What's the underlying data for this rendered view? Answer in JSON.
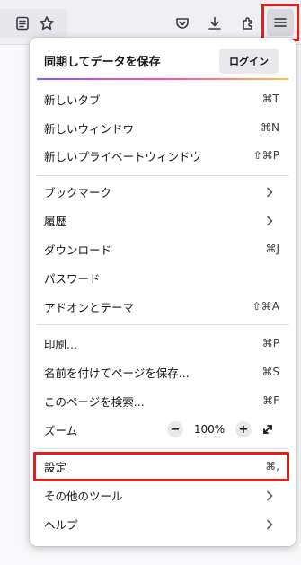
{
  "toolbar": {
    "icons": [
      "reader-view-icon",
      "bookmark-star-icon",
      "pocket-icon",
      "download-icon",
      "extensions-icon",
      "hamburger-menu-icon"
    ]
  },
  "menu": {
    "sync_label": "同期してデータを保存",
    "login_label": "ログイン",
    "items": {
      "new_tab": {
        "label": "新しいタブ",
        "shortcut": "⌘T"
      },
      "new_window": {
        "label": "新しいウィンドウ",
        "shortcut": "⌘N"
      },
      "new_private_window": {
        "label": "新しいプライベートウィンドウ",
        "shortcut": "⇧⌘P"
      },
      "bookmarks": {
        "label": "ブックマーク"
      },
      "history": {
        "label": "履歴"
      },
      "downloads": {
        "label": "ダウンロード",
        "shortcut": "⌘J"
      },
      "passwords": {
        "label": "パスワード"
      },
      "addons": {
        "label": "アドオンとテーマ",
        "shortcut": "⇧⌘A"
      },
      "print": {
        "label": "印刷...",
        "shortcut": "⌘P"
      },
      "save_page": {
        "label": "名前を付けてページを保存...",
        "shortcut": "⌘S"
      },
      "find": {
        "label": "このページを検索...",
        "shortcut": "⌘F"
      },
      "settings": {
        "label": "設定",
        "shortcut": "⌘,"
      },
      "more_tools": {
        "label": "その他のツール"
      },
      "help": {
        "label": "ヘルプ"
      }
    },
    "zoom": {
      "label": "ズーム",
      "minus": "−",
      "value": "100%",
      "plus": "+"
    }
  },
  "colors": {
    "highlight": "#e0201b",
    "panel_bg": "#ffffff",
    "toolbar_bg": "#f0f0f4"
  }
}
